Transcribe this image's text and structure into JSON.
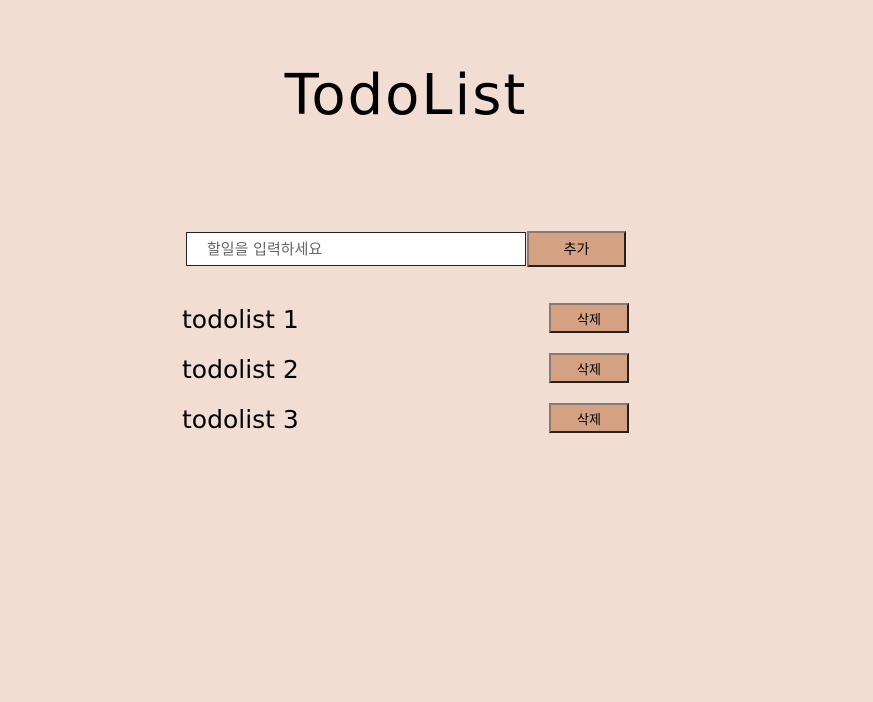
{
  "header": {
    "title": "TodoList"
  },
  "add_form": {
    "input_placeholder": "할일을 입력하세요",
    "input_value": "",
    "add_label": "추가"
  },
  "todos": [
    {
      "text": "todolist 1",
      "delete_label": "삭제"
    },
    {
      "text": "todolist 2",
      "delete_label": "삭제"
    },
    {
      "text": "todolist 3",
      "delete_label": "삭제"
    }
  ],
  "colors": {
    "background": "#f1ddd2",
    "button": "#d4a283",
    "input_background": "#ffffff"
  }
}
